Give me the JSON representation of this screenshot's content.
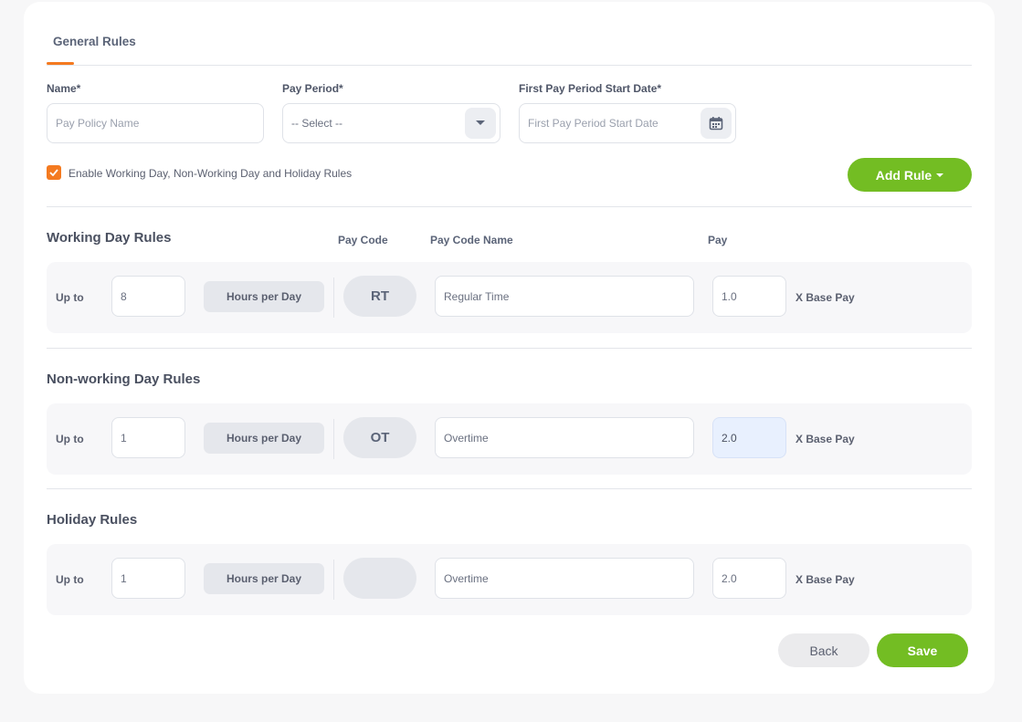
{
  "tabs": [
    {
      "label": "General Rules",
      "active": true
    }
  ],
  "form": {
    "name": {
      "label": "Name*",
      "placeholder": "Pay Policy Name",
      "value": ""
    },
    "pay_period": {
      "label": "Pay Period*",
      "value": "-- Select --"
    },
    "start_date": {
      "label": "First Pay Period Start Date*",
      "placeholder": "First Pay Period Start Date",
      "value": ""
    },
    "enable_rules": {
      "label": "Enable Working Day, Non-Working Day and Holiday Rules",
      "checked": true
    },
    "add_rule_label": "Add Rule"
  },
  "columns": {
    "pay_code": "Pay Code",
    "pay_code_name": "Pay Code Name",
    "pay": "Pay"
  },
  "sections": [
    {
      "title": "Working Day Rules",
      "rule": {
        "upto_label": "Up to",
        "hours": "8",
        "unit": "Hours per Day",
        "pay_code": "RT",
        "pay_code_name": "Regular Time",
        "pay": "1.0",
        "pay_suffix": "X Base Pay"
      }
    },
    {
      "title": "Non-working Day Rules",
      "rule": {
        "upto_label": "Up to",
        "hours": "1",
        "unit": "Hours per Day",
        "pay_code": "OT",
        "pay_code_name": "Overtime",
        "pay": "2.0",
        "pay_suffix": "X Base Pay"
      }
    },
    {
      "title": "Holiday Rules",
      "rule": {
        "upto_label": "Up to",
        "hours": "1",
        "unit": "Hours per Day",
        "pay_code": "",
        "pay_code_name": "Overtime",
        "pay": "2.0",
        "pay_suffix": "X Base Pay"
      }
    }
  ],
  "actions": {
    "back": "Back",
    "save": "Save"
  },
  "colors": {
    "accent": "#f47a20",
    "primary_green": "#73bd23",
    "highlight_input": "#e8f0fe"
  },
  "icons": {
    "dropdown": "chevron-down-icon",
    "calendar": "calendar-icon",
    "checkbox": "check-icon"
  }
}
